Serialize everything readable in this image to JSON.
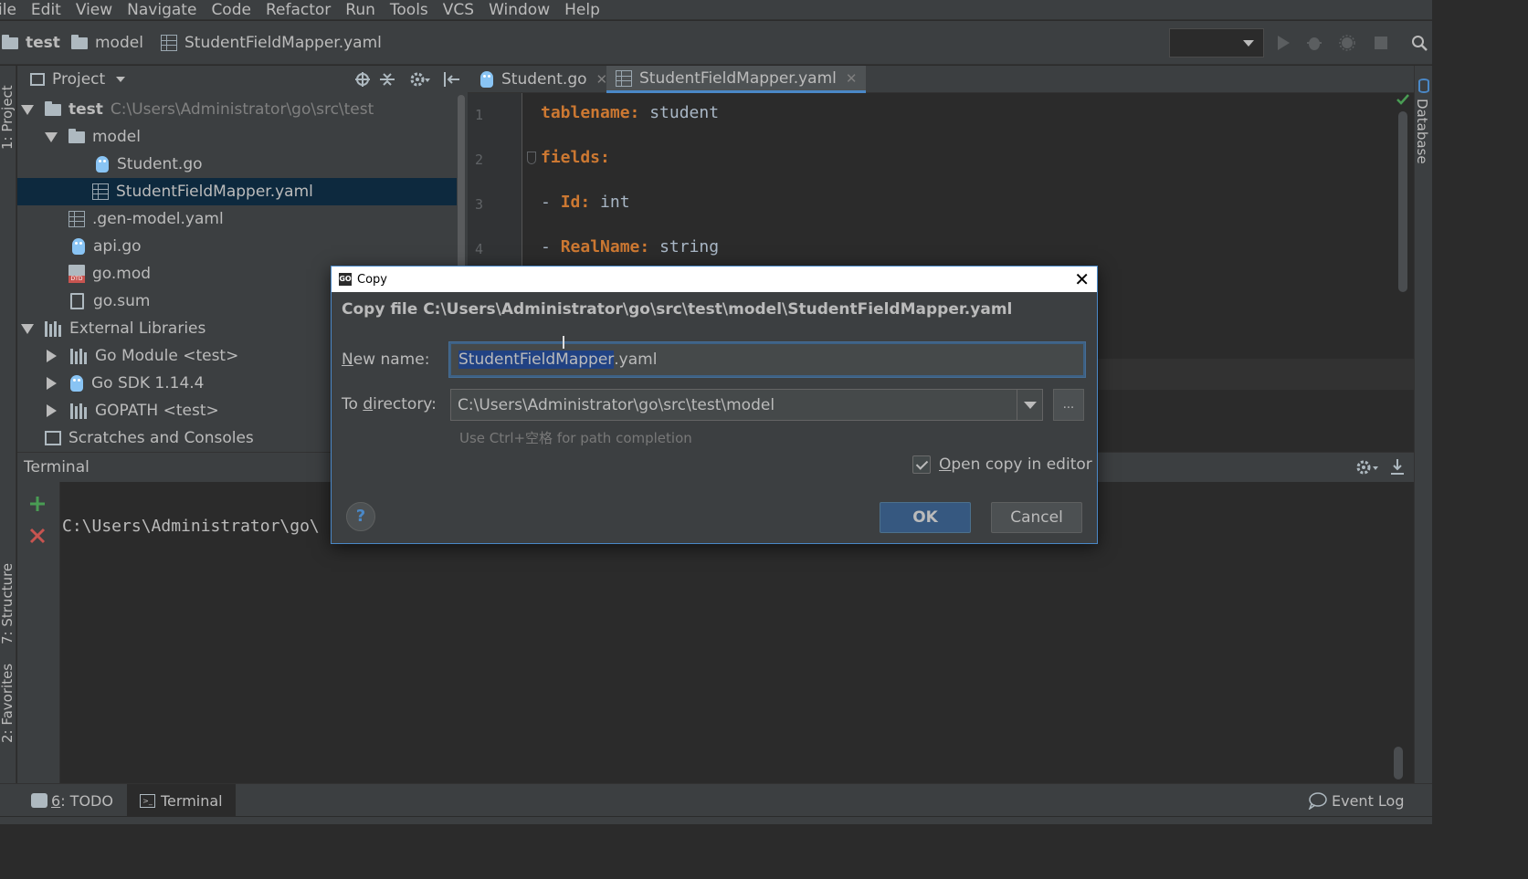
{
  "menu": [
    "ile",
    "Edit",
    "View",
    "Navigate",
    "Code",
    "Refactor",
    "Run",
    "Tools",
    "VCS",
    "Window",
    "Help"
  ],
  "breadcrumbs": [
    "test",
    "model",
    "StudentFieldMapper.yaml"
  ],
  "left_stripe": {
    "project": "1: Project",
    "structure": "7: Structure",
    "favorites": "2: Favorites"
  },
  "right_stripe": {
    "database": "Database"
  },
  "project_panel": {
    "title": "Project",
    "tree": [
      {
        "label": "test",
        "path": "C:\\Users\\Administrator\\go\\src\\test"
      },
      {
        "label": "model"
      },
      {
        "label": "Student.go"
      },
      {
        "label": "StudentFieldMapper.yaml"
      },
      {
        "label": ".gen-model.yaml"
      },
      {
        "label": "api.go"
      },
      {
        "label": "go.mod"
      },
      {
        "label": "go.sum"
      },
      {
        "label": "External Libraries"
      },
      {
        "label": "Go Module <test>"
      },
      {
        "label": "Go SDK 1.14.4"
      },
      {
        "label": "GOPATH <test>"
      },
      {
        "label": "Scratches and Consoles"
      }
    ]
  },
  "editor": {
    "tabs": [
      "Student.go",
      "StudentFieldMapper.yaml"
    ],
    "lines": [
      {
        "num": "1",
        "key": "tablename:",
        "value": " student",
        "prefix": ""
      },
      {
        "num": "2",
        "key": "fields:",
        "value": "",
        "prefix": ""
      },
      {
        "num": "3",
        "key": "Id:",
        "value": " int",
        "prefix": "- "
      },
      {
        "num": "4",
        "key": "RealName:",
        "value": " string",
        "prefix": "- "
      }
    ]
  },
  "terminal": {
    "title": "Terminal",
    "prompt": "C:\\Users\\Administrator\\go\\"
  },
  "bottom_tabs": {
    "todo_num": "6",
    "todo": ": TODO",
    "terminal": "Terminal",
    "event_log": "Event Log"
  },
  "dialog": {
    "window_title": "Copy",
    "heading": "Copy file C:\\Users\\Administrator\\go\\src\\test\\model\\StudentFieldMapper.yaml",
    "new_name_label_u": "N",
    "new_name_label_rest": "ew name:",
    "new_name_selected": "StudentFieldMapper",
    "new_name_rest": ".yaml",
    "dir_label_pre": "To ",
    "dir_label_u": "d",
    "dir_label_rest": "irectory:",
    "dir_value": "C:\\Users\\Administrator\\go\\src\\test\\model",
    "browse": "...",
    "hint": "Use Ctrl+空格 for path completion",
    "open_copy_u": "O",
    "open_copy_rest": "pen copy in editor",
    "ok": "OK",
    "cancel": "Cancel",
    "help": "?"
  },
  "colors": {
    "accent": "#4a88c7",
    "keyword": "#cc7832",
    "selection": "#214283"
  }
}
